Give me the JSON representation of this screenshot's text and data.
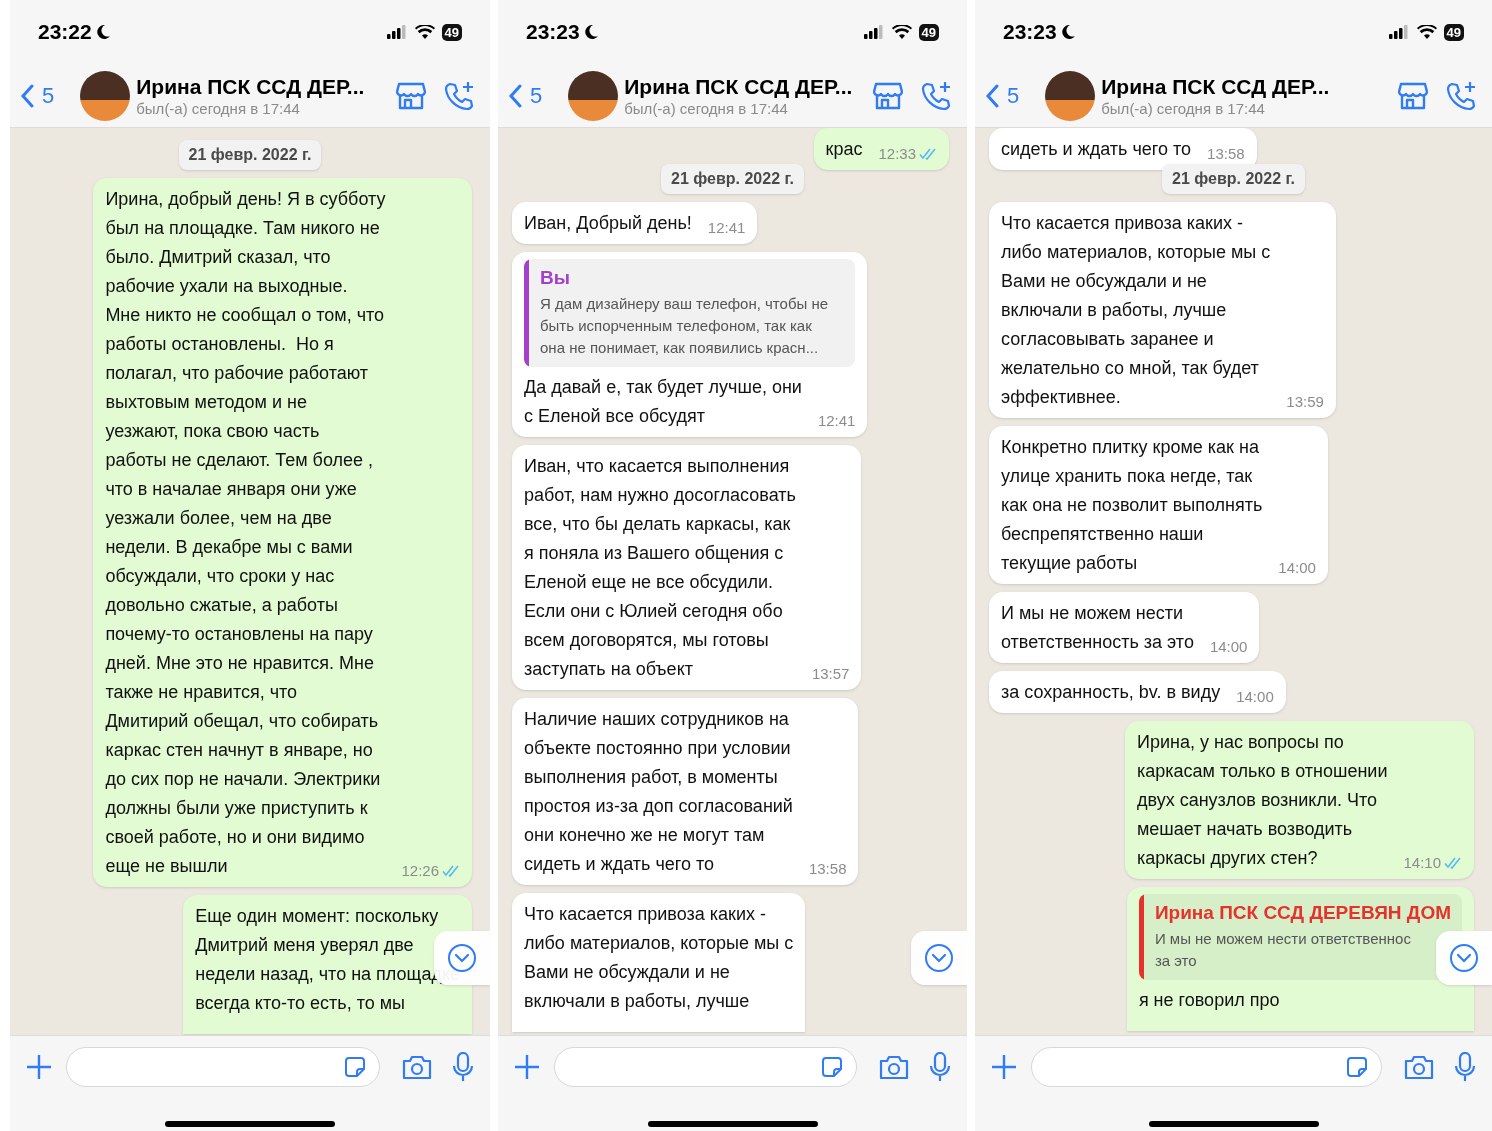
{
  "panels": [
    {
      "status_bar": {
        "time": "23:22",
        "battery": "49"
      },
      "header": {
        "back_count": "5",
        "name": "Ирина ПСК ССД ДЕР...",
        "last_seen": "был(-а) сегодня в 17:44"
      },
      "messages": [
        {
          "kind": "date",
          "text": "21 февр. 2022 г."
        },
        {
          "kind": "out",
          "text": "Ирина, добрый день! Я в субботу\nбыл на площадке. Там никого не\nбыло. Дмитрий сказал, что\nрабочие ухали на выходные.\nМне никто не сообщал о том, что\nработы остановлены.  Но я\nполагал, что рабочие работают\nвыхтовым методом и не\nуезжают, пока свою часть\nработы не сделают. Тем более ,\nчто в началае января они уже\nуезжали более, чем на две\nнедели. В декабре мы с вами\nобсуждали, что сроки у нас\nдовольно сжатые, а работы\nпочему-то остановлены на пару\nдней. Мне это не нравится. Мне\nтакже не нравится, что\nДмитирий обещал, что собирать\nкаркас стен начнут в январе, но\nдо сих пор не начали. Электрики\nдолжны были уже приступить к\nсвоей работе, но и они видимо\nеще не вышли",
          "time": "12:26",
          "read": true,
          "cut": false
        },
        {
          "kind": "out",
          "text": "Еще один момент: поскольку\nДмитрий меня уверял две\nнедели назад, что на площадке\nвсегда кто-то есть, то мы",
          "cut": true
        }
      ]
    },
    {
      "status_bar": {
        "time": "23:23",
        "battery": "49"
      },
      "header": {
        "back_count": "5",
        "name": "Ирина ПСК ССД ДЕР...",
        "last_seen": "был(-а) сегодня в 17:44"
      },
      "messages": [
        {
          "kind": "out",
          "text": "крас",
          "time": "12:33",
          "read": true,
          "cut": false
        },
        {
          "kind": "date",
          "text": "21 февр. 2022 г."
        },
        {
          "kind": "in",
          "text": "Иван, Добрый день!",
          "time": "12:41",
          "cut": false
        },
        {
          "kind": "in",
          "quote": {
            "author": "Вы",
            "color": "#a33fc9",
            "text": "Я дам дизайнеру ваш телефон, чтобы не\nбыть испорченным телефоном, так как\nона не понимает, как появились красн..."
          },
          "text": "Да давай е, так будет лучше, они\nс Еленой все обсудят",
          "time": "12:41",
          "cut": false
        },
        {
          "kind": "in",
          "text": "Иван, что касается выполнения\nработ, нам нужно досогласовать\nвсе, что бы делать каркасы, как\nя поняла из Вашего общения с\nЕленой еще не все обсудили.\nЕсли они с Юлией сегодня обо\nвсем договорятся, мы готовы\nзаступать на объект",
          "time": "13:57",
          "cut": false
        },
        {
          "kind": "in",
          "text": "Наличие наших сотрудников на\nобъекте постоянно при условии\nвыполнения работ, в моменты\nпростоя из-за доп согласований\nони конечно же не могут там\nсидеть и ждать чего то",
          "time": "13:58",
          "cut": false
        },
        {
          "kind": "in",
          "text": "Что касается привоза каких -\nлибо материалов, которые мы с\nВами не обсуждали и не\nвключали в работы, лучше",
          "cut": true
        }
      ]
    },
    {
      "status_bar": {
        "time": "23:23",
        "battery": "49"
      },
      "header": {
        "back_count": "5",
        "name": "Ирина ПСК ССД ДЕР...",
        "last_seen": "был(-а) сегодня в 17:44"
      },
      "messages": [
        {
          "kind": "in",
          "text": "сидеть и ждать чего то",
          "time": "13:58",
          "cut": false
        },
        {
          "kind": "date",
          "text": "21 февр. 2022 г."
        },
        {
          "kind": "in",
          "text": "Что касается привоза каких -\nлибо материалов, которые мы с\nВами не обсуждали и не\nвключали в работы, лучше\nсогласовывать заранее и\nжелательно со мной, так будет\nэффективнее.",
          "time": "13:59",
          "cut": false
        },
        {
          "kind": "in",
          "text": "Конкретно плитку кроме как на\nулице хранить пока негде, так\nкак она не позволит выполнять\nбеспрепятственно наши\nтекущие работы",
          "time": "14:00",
          "cut": false
        },
        {
          "kind": "in",
          "text": "И мы не можем нести\nответственность за это",
          "time": "14:00",
          "cut": false
        },
        {
          "kind": "in",
          "text": "за сохранность, bv. в виду",
          "time": "14:00",
          "cut": false
        },
        {
          "kind": "out",
          "text": "Ирина, у нас вопросы по\nкаркасам только в отношении\nдвух санузлов возникли. Что\nмешает начать возводить\nкаркасы других стен?",
          "time": "14:10",
          "read": true,
          "cut": false
        },
        {
          "kind": "out",
          "quote": {
            "author": "Ирина ПСК ССД ДЕРЕВЯН ДОМ",
            "color": "#e5322d",
            "text": "И мы не можем нести ответственнос\nза это"
          },
          "text": "я не говорил про",
          "cut": true
        }
      ]
    }
  ]
}
